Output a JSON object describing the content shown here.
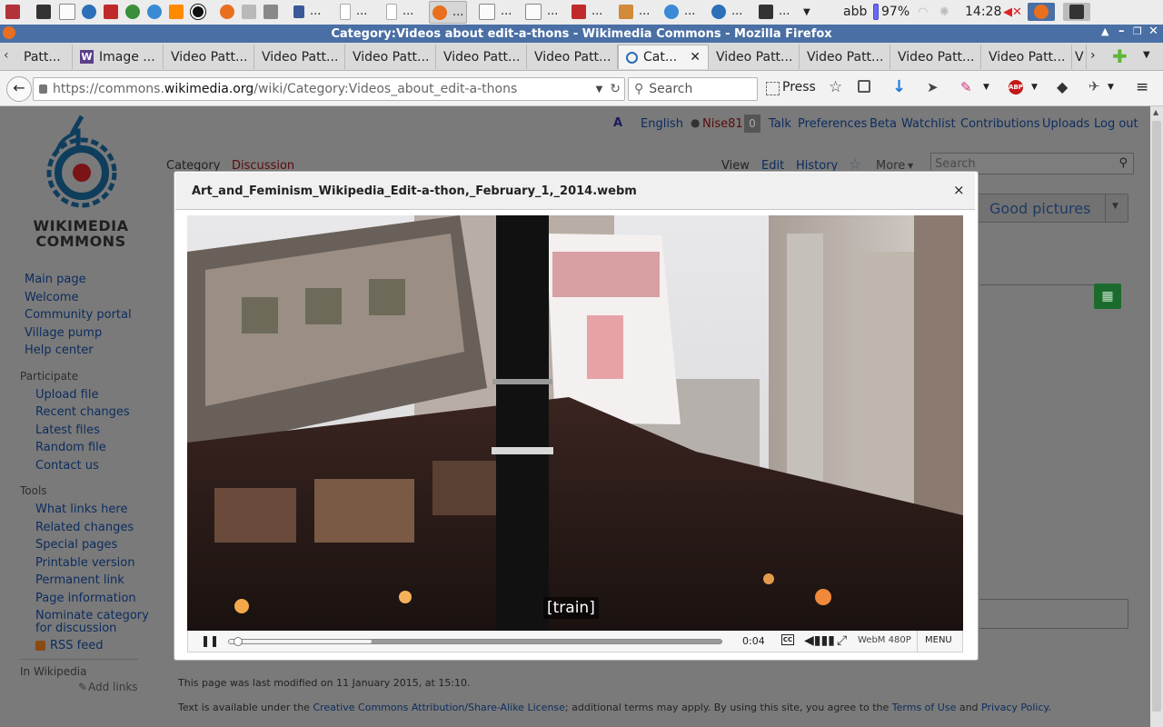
{
  "taskbar": {
    "tasks": [
      "...",
      "...",
      "...",
      "...",
      "...",
      "...",
      "...",
      "...",
      "...",
      "...",
      "..."
    ],
    "keyboard_layout": "abb",
    "battery": "97%",
    "clock": "14:28"
  },
  "window": {
    "title": "Category:Videos about edit-a-thons - Wikimedia Commons - Mozilla Firefox"
  },
  "tabs": [
    {
      "label": "Patt..."
    },
    {
      "label": "Image ..."
    },
    {
      "label": "Video Patt..."
    },
    {
      "label": "Video Patt..."
    },
    {
      "label": "Video Patt..."
    },
    {
      "label": "Video Patt..."
    },
    {
      "label": "Video Patt..."
    },
    {
      "label": "Cat..."
    },
    {
      "label": "Video Patt..."
    },
    {
      "label": "Video Patt..."
    },
    {
      "label": "Video Patt..."
    },
    {
      "label": "Video Patt..."
    },
    {
      "label": "V"
    }
  ],
  "navbar": {
    "url_prefix": "https://commons.",
    "url_domain": "wikimedia.org",
    "url_path": "/wiki/Category:Videos_about_edit-a-thons",
    "search_placeholder": "Search",
    "press_label": "Press"
  },
  "wiki": {
    "logo_line1": "WIKIMEDIA",
    "logo_line2": "COMMONS",
    "user_links": {
      "language": "English",
      "username": "Nise81",
      "notifications": "0",
      "talk": "Talk",
      "preferences": "Preferences",
      "beta": "Beta",
      "watchlist": "Watchlist",
      "contributions": "Contributions",
      "uploads": "Uploads",
      "logout": "Log out"
    },
    "page_tabs": {
      "category": "Category",
      "discussion": "Discussion",
      "view": "View",
      "edit": "Edit",
      "history": "History",
      "more": "More"
    },
    "search_placeholder": "Search",
    "good_pictures": "Good pictures",
    "sidebar": {
      "nav": [
        "Main page",
        "Welcome",
        "Community portal",
        "Village pump",
        "Help center"
      ],
      "participate_heading": "Participate",
      "participate": [
        "Upload file",
        "Recent changes",
        "Latest files",
        "Random file",
        "Contact us"
      ],
      "tools_heading": "Tools",
      "tools": [
        "What links here",
        "Related changes",
        "Special pages",
        "Printable version",
        "Permanent link",
        "Page information"
      ],
      "nominate_line1": "Nominate category",
      "nominate_line2": "for discussion",
      "rss": "RSS feed",
      "in_wikipedia": "In Wikipedia",
      "add_links": "Add links"
    },
    "footer": {
      "last_modified": "This page was last modified on 11 January 2015, at 15:10.",
      "license_prefix": "Text is available under the ",
      "license_link": "Creative Commons Attribution/Share-Alike License",
      "license_mid": "; additional terms may apply. By using this site, you agree to the ",
      "terms": "Terms of Use",
      "and": " and ",
      "privacy": "Privacy Policy",
      "end": "."
    }
  },
  "dialog": {
    "title": "Art_and_Feminism_Wikipedia_Edit-a-thon,_February_1,_2014.webm",
    "close": "×",
    "caption": "[train]",
    "time": "0:04",
    "format": "WebM 480P",
    "menu": "MENU",
    "progress_fraction": 0.01,
    "buffered_fraction": 0.29
  }
}
